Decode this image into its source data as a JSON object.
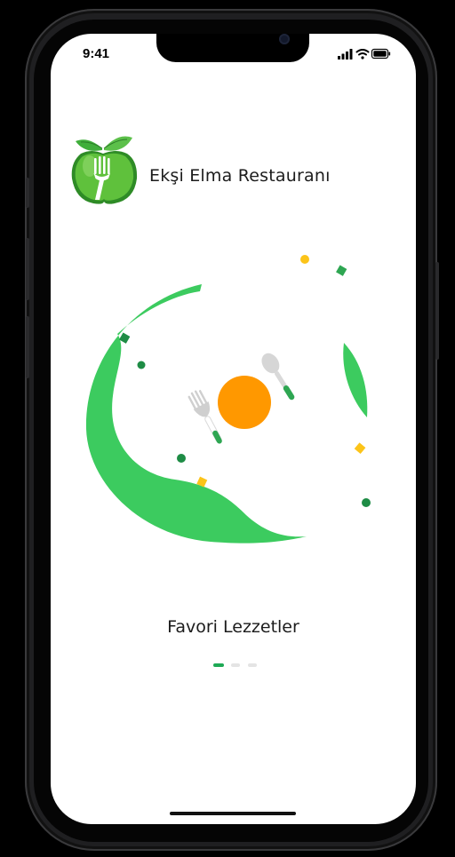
{
  "status_bar": {
    "time": "9:41",
    "icons": [
      "signal-icon",
      "wifi-icon",
      "battery-icon"
    ]
  },
  "header": {
    "app_name": "Ekşi Elma Restauranı",
    "logo_icon": "apple-fork-logo"
  },
  "onboarding": {
    "title": "Favori Lezzetler",
    "page_count": 3,
    "active_page": 1,
    "illustration": "plate-fork-spoon-illustration"
  },
  "colors": {
    "accent": "#1ea955",
    "leaf": "#3ccb5f",
    "plate": "#ff9800",
    "confetti_yellow": "#fcc419",
    "confetti_green": "#1e8c45",
    "background": "#ffffff"
  }
}
